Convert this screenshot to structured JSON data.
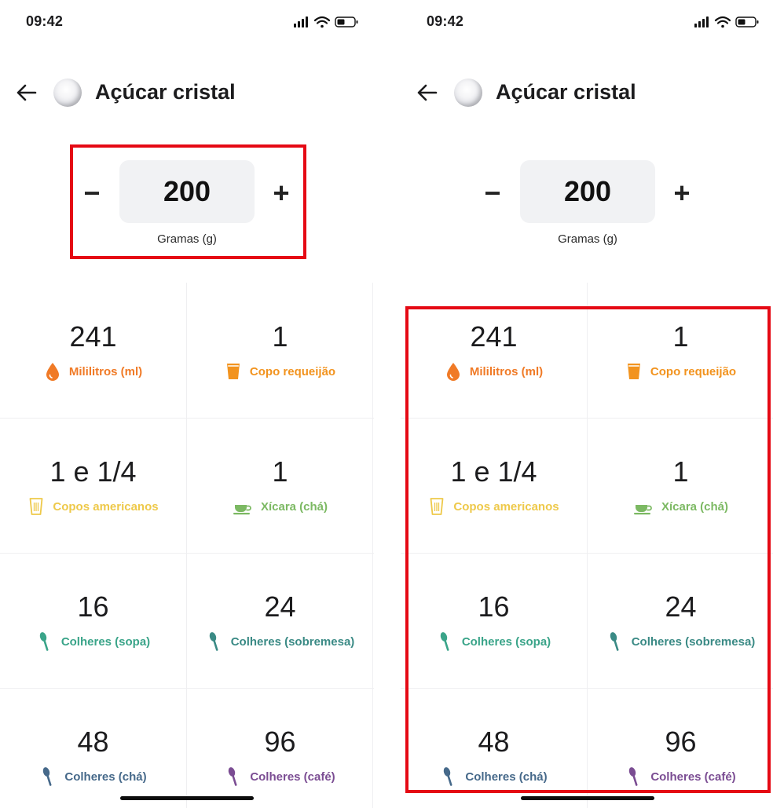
{
  "status_bar": {
    "time": "09:42"
  },
  "header": {
    "title": "Açúcar cristal"
  },
  "stepper": {
    "minus": "−",
    "plus": "+",
    "value": "200",
    "unit": "Gramas (g)"
  },
  "measures": [
    {
      "value": "241",
      "label": "Mililitros (ml)",
      "color": "#f07a26",
      "icon": "drop-icon"
    },
    {
      "value": "1",
      "label": "Copo requeijão",
      "color": "#f2931e",
      "icon": "glass-icon"
    },
    {
      "value": "1 e 1/4",
      "label": "Copos americanos",
      "color": "#eec94a",
      "icon": "cup-outline-icon"
    },
    {
      "value": "1",
      "label": "Xícara (chá)",
      "color": "#7cb963",
      "icon": "teacup-icon"
    },
    {
      "value": "16",
      "label": "Colheres (sopa)",
      "color": "#3aa489",
      "icon": "spoon-icon"
    },
    {
      "value": "24",
      "label": "Colheres (sobremesa)",
      "color": "#3a8a85",
      "icon": "spoon-icon"
    },
    {
      "value": "48",
      "label": "Colheres (chá)",
      "color": "#46698a",
      "icon": "spoon-icon"
    },
    {
      "value": "96",
      "label": "Colheres (café)",
      "color": "#7b4d93",
      "icon": "spoon-icon"
    }
  ],
  "highlight_color": "#e50914"
}
